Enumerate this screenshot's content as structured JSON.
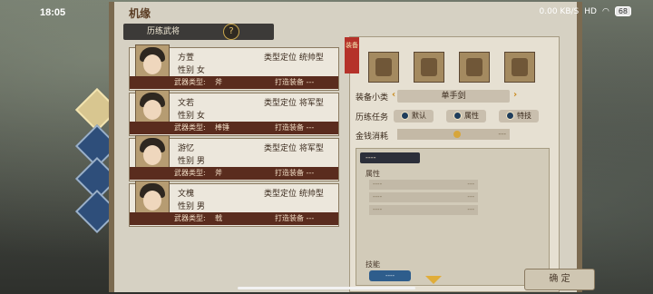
{
  "status": {
    "time": "18:05",
    "speed": "0.00\nKB/S",
    "battery": "68"
  },
  "scroll_title": "机缘",
  "list_header": "历练武将",
  "help_icon": "?",
  "generals": [
    {
      "name": "方萱",
      "gender": "性别 女",
      "ptype": "类型定位 统帅型",
      "weapon_label": "武器类型:",
      "weapon": "斧",
      "equip": "打造装备 ---"
    },
    {
      "name": "文若",
      "gender": "性别 女",
      "ptype": "类型定位 将军型",
      "weapon_label": "武器类型:",
      "weapon": "棒锤",
      "equip": "打造装备 ---"
    },
    {
      "name": "游忆",
      "gender": "性别 男",
      "ptype": "类型定位 将军型",
      "weapon_label": "武器类型:",
      "weapon": "斧",
      "equip": "打造装备 ---"
    },
    {
      "name": "文槐",
      "gender": "性别 男",
      "ptype": "类型定位 统帅型",
      "weapon_label": "武器类型:",
      "weapon": "戟",
      "equip": "打造装备 ---"
    }
  ],
  "panel": {
    "banner": "装备",
    "subcategory_label": "装备小类",
    "subcategory_value": "单手剑",
    "task_label": "历练任务",
    "tasks": [
      "默认",
      "属性",
      "特技"
    ],
    "coin_label": "金钱消耗",
    "coin_value": "---",
    "detail_header": "----",
    "attr_label": "属性",
    "attr_rows": [
      {
        "l": "----",
        "r": "---"
      },
      {
        "l": "----",
        "r": "---"
      },
      {
        "l": "----",
        "r": "---"
      }
    ],
    "skill_label": "技能",
    "skill_buttons": [
      "----",
      "----"
    ]
  },
  "confirm": "确 定",
  "colors": {
    "accent": "#b5322a",
    "card_footer": "#5a2c1e",
    "skill_button": "#2e5d8c"
  }
}
